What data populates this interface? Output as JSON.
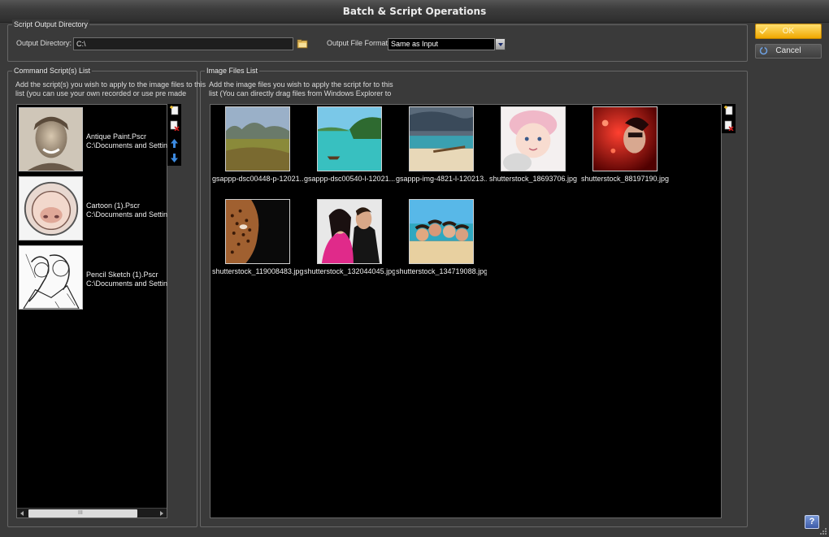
{
  "window": {
    "title": "Batch & Script Operations"
  },
  "output": {
    "group_title": "Script Output Directory",
    "dir_label": "Output Directory:",
    "dir_value": "C:\\",
    "format_label": "Output File Format:",
    "format_value": "Same as Input"
  },
  "buttons": {
    "ok": "OK",
    "cancel": "Cancel",
    "help": "?"
  },
  "scripts": {
    "group_title": "Command Script(s) List",
    "hint_line1": "Add the script(s) you wish to apply to the image files to this",
    "hint_line2": "list (you can use your own recorded or use pre made",
    "items": [
      {
        "name": "Antique Paint.Pscr",
        "path": "C:\\Documents and Settings"
      },
      {
        "name": "Cartoon (1).Pscr",
        "path": "C:\\Documents and Settings"
      },
      {
        "name": "Pencil Sketch (1).Pscr",
        "path": "C:\\Documents and Settings"
      }
    ],
    "scroll_grip": "III"
  },
  "images": {
    "group_title": "Image Files List",
    "hint_line1": "Add the image files you wish to apply the script for to this",
    "hint_line2": "list (You can directly drag files from Windows Explorer to",
    "items": [
      {
        "caption": "gsappp-dsc00448-p-12021..."
      },
      {
        "caption": "gsappp-dsc00540-l-12021..."
      },
      {
        "caption": "gsappp-img-4821-l-120213..."
      },
      {
        "caption": "shutterstock_18693706.jpg"
      },
      {
        "caption": "shutterstock_88197190.jpg"
      },
      {
        "caption": "shutterstock_119008483.jpg"
      },
      {
        "caption": "shutterstock_132044045.jpg"
      },
      {
        "caption": "shutterstock_134719088.jpg"
      }
    ]
  },
  "icons": {
    "browse": "folder-icon",
    "add": "add-file-icon",
    "remove": "remove-file-icon",
    "up": "arrow-up-icon",
    "down": "arrow-down-icon"
  },
  "colors": {
    "accent": "#f0a800",
    "panel": "#000000",
    "background": "#3a3a3a"
  }
}
